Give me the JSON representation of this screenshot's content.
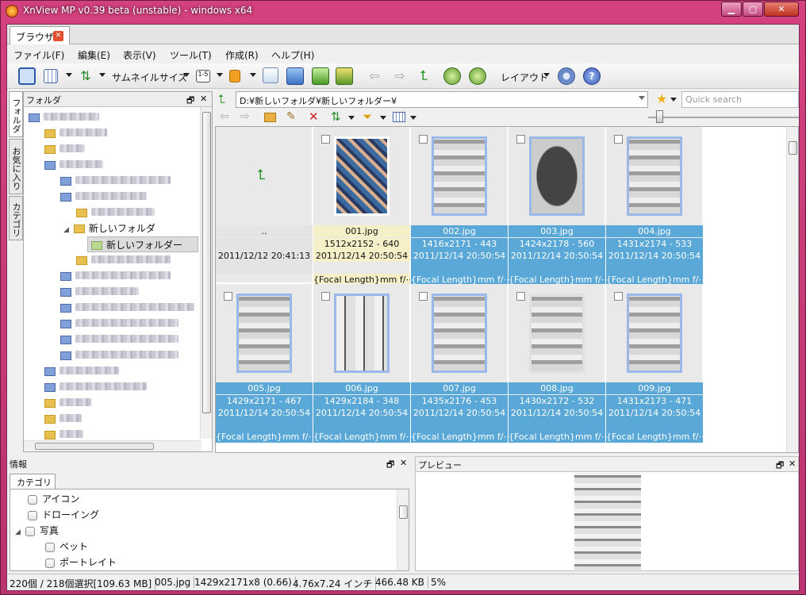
{
  "window": {
    "title": "XnView MP v0.39 beta (unstable) - windows x64",
    "min": "▁",
    "max": "▢",
    "close": "✕"
  },
  "tabs": [
    {
      "label": "ブラウザ"
    }
  ],
  "menu": [
    "ファイル(F)",
    "編集(E)",
    "表示(V)",
    "ツール(T)",
    "作成(R)",
    "ヘルプ(H)"
  ],
  "toolbar": {
    "thumb_size_label": "サムネイルサイズ",
    "layout_label": "レイアウト"
  },
  "side_tabs": [
    "フォルダ",
    "お気に入り",
    "カテゴリ"
  ],
  "folder_pane": {
    "title": "フォルダ",
    "visible_items": [
      {
        "label": "新しいフォルダ",
        "level": 3,
        "expanded": true
      },
      {
        "label": "新しいフォルダー",
        "level": 4,
        "selected": true
      }
    ]
  },
  "address": {
    "path": "D:¥新しいフォルダ¥新しいフォルダー¥",
    "search_placeholder": "Quick search"
  },
  "thumbnails": [
    {
      "name": "..",
      "dims": "",
      "date": "2011/12/12 20:41:13",
      "extra": "",
      "parent": true
    },
    {
      "name": "001.jpg",
      "dims": "1512x2152 - 640",
      "date": "2011/12/14 20:50:54",
      "extra": "{Focal Length}mm f/⋯",
      "selected": true
    },
    {
      "name": "002.jpg",
      "dims": "1416x2171 - 443",
      "date": "2011/12/14 20:50:54",
      "extra": "{Focal Length}mm f/⋯"
    },
    {
      "name": "003.jpg",
      "dims": "1424x2178 - 560",
      "date": "2011/12/14 20:50:54",
      "extra": "{Focal Length}mm f/⋯"
    },
    {
      "name": "004.jpg",
      "dims": "1431x2174 - 533",
      "date": "2011/12/14 20:50:54",
      "extra": "{Focal Length}mm f/⋯"
    },
    {
      "name": "005.jpg",
      "dims": "1429x2171 - 467",
      "date": "2011/12/14 20:50:54",
      "extra": "{Focal Length}mm f/⋯"
    },
    {
      "name": "006.jpg",
      "dims": "1429x2184 - 348",
      "date": "2011/12/14 20:50:54",
      "extra": "{Focal Length}mm f/⋯"
    },
    {
      "name": "007.jpg",
      "dims": "1435x2176 - 453",
      "date": "2011/12/14 20:50:54",
      "extra": "{Focal Length}mm f/⋯"
    },
    {
      "name": "008.jpg",
      "dims": "1430x2172 - 532",
      "date": "2011/12/14 20:50:54",
      "extra": "{Focal Length}mm f/⋯"
    },
    {
      "name": "009.jpg",
      "dims": "1431x2173 - 471",
      "date": "2011/12/14 20:50:54",
      "extra": "{Focal Length}mm f/⋯"
    }
  ],
  "info_pane": {
    "title": "情報",
    "tab": "カテゴリ",
    "categories": [
      {
        "label": "アイコン",
        "level": 1
      },
      {
        "label": "ドローイング",
        "level": 1
      },
      {
        "label": "写真",
        "level": 1,
        "expanded": true
      },
      {
        "label": "ペット",
        "level": 2
      },
      {
        "label": "ポートレイト",
        "level": 2
      }
    ]
  },
  "preview_pane": {
    "title": "プレビュー"
  },
  "pane_controls": {
    "float": "🗗",
    "close": "✕"
  },
  "status": {
    "count": "220個 / 218個選択[109.63 MB]",
    "file": "005.jpg",
    "dims": "1429x2171x8 (0.66)",
    "size_inch": "4.76x7.24 インチ",
    "filesize": "466.48 KB",
    "zoom": "5%"
  },
  "colors": {
    "title_bar": "#c23a78",
    "thumb_label_bg": "#5aa8d8",
    "selected_label_bg": "#f5f0c8"
  }
}
